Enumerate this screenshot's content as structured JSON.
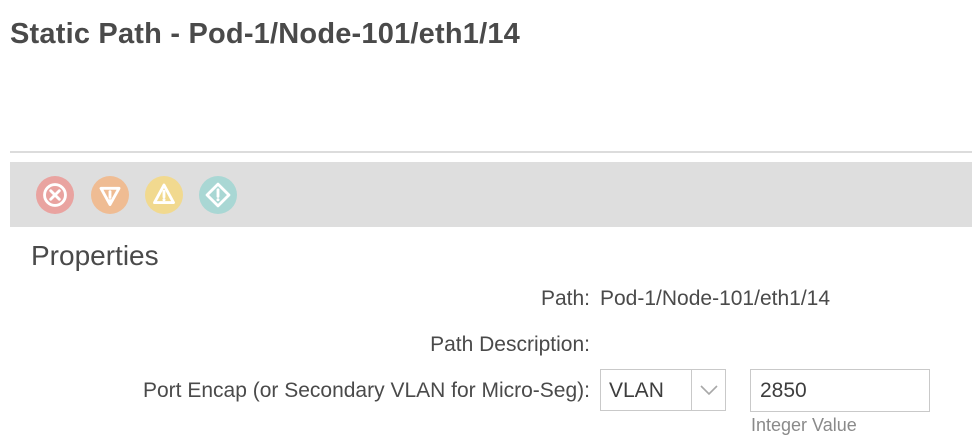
{
  "header": {
    "title": "Static Path - Pod-1/Node-101/eth1/14"
  },
  "fault_bar": {
    "icons": [
      {
        "name": "critical-fault-icon",
        "color": "#e57373",
        "glyph": "x"
      },
      {
        "name": "major-fault-icon",
        "color": "#f0a877",
        "glyph": "!"
      },
      {
        "name": "minor-fault-icon",
        "color": "#f2d27a",
        "glyph": "!"
      },
      {
        "name": "warning-fault-icon",
        "color": "#8ed1cf",
        "glyph": "!"
      }
    ]
  },
  "properties": {
    "section_title": "Properties",
    "path_label": "Path:",
    "path_value": "Pod-1/Node-101/eth1/14",
    "path_description_label": "Path Description:",
    "port_encap_label": "Port Encap (or Secondary VLAN for Micro-Seg):",
    "encap_type": "VLAN",
    "encap_value": "2850",
    "encap_hint": "Integer Value"
  }
}
